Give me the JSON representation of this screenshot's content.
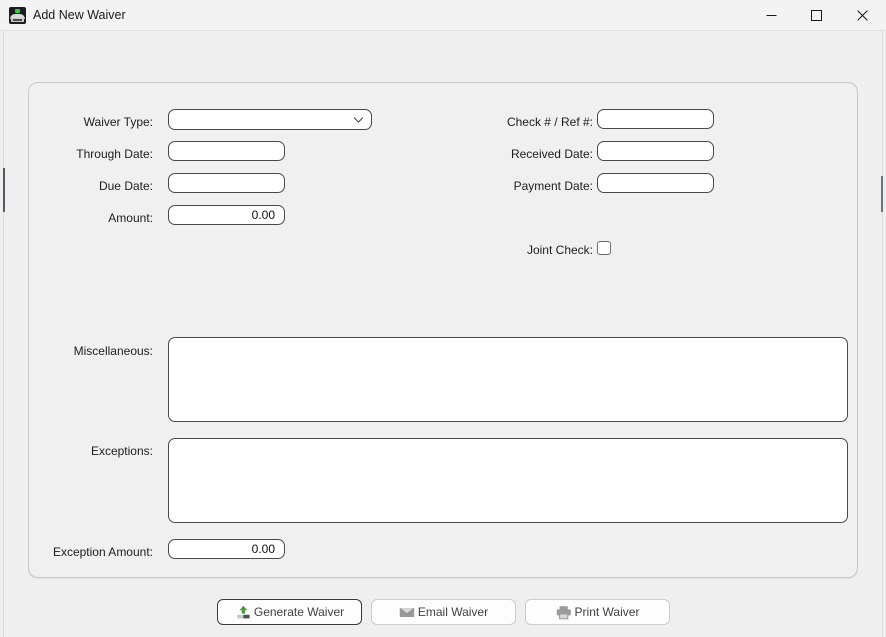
{
  "window": {
    "title": "Add New Waiver",
    "icon": "app-house-icon",
    "controls": {
      "minimize": "minimize-icon",
      "maximize": "maximize-icon",
      "close": "close-icon"
    }
  },
  "form": {
    "left": [
      {
        "label": "Waiver Type:",
        "type": "combobox",
        "value": "",
        "placeholder": ""
      },
      {
        "label": "Through Date:",
        "type": "text",
        "value": "",
        "placeholder": ""
      },
      {
        "label": "Due Date:",
        "type": "text",
        "value": "",
        "placeholder": ""
      },
      {
        "label": "Amount:",
        "type": "number",
        "value": "0.00",
        "placeholder": ""
      }
    ],
    "right": [
      {
        "label": "Check # / Ref #:",
        "type": "text",
        "value": "",
        "placeholder": ""
      },
      {
        "label": "Received Date:",
        "type": "text",
        "value": "",
        "placeholder": ""
      },
      {
        "label": "Payment Date:",
        "type": "text",
        "value": "",
        "placeholder": ""
      },
      {
        "label": "Joint Check:",
        "type": "checkbox",
        "value": "",
        "checked": false
      }
    ],
    "notes": [
      {
        "label": "Miscellaneous:",
        "type": "textarea",
        "value": "",
        "placeholder": ""
      },
      {
        "label": "Exceptions:",
        "type": "textarea",
        "value": "",
        "placeholder": ""
      }
    ],
    "exception_amount": {
      "label": "Exception Amount:",
      "value": "0.00",
      "placeholder": ""
    }
  },
  "actions": {
    "buttons": [
      {
        "label": "Generate Waiver",
        "icon": "upload-arrow-icon",
        "focused": true
      },
      {
        "label": "Email Waiver",
        "icon": "envelope-icon",
        "focused": false
      },
      {
        "label": "Print Waiver",
        "icon": "printer-icon",
        "focused": false
      }
    ]
  },
  "colors": {
    "window_bg": "#efefef",
    "titlebar_bg": "#f3f3f3",
    "panel_bg": "#f0f0f0",
    "field_bg": "#ffffff",
    "field_border": "#4a4a4a",
    "text": "#1d1d1d",
    "button_text": "#3f3f46",
    "accent_green": "#4e9a3f",
    "icon_gray": "#8a8a8a"
  }
}
